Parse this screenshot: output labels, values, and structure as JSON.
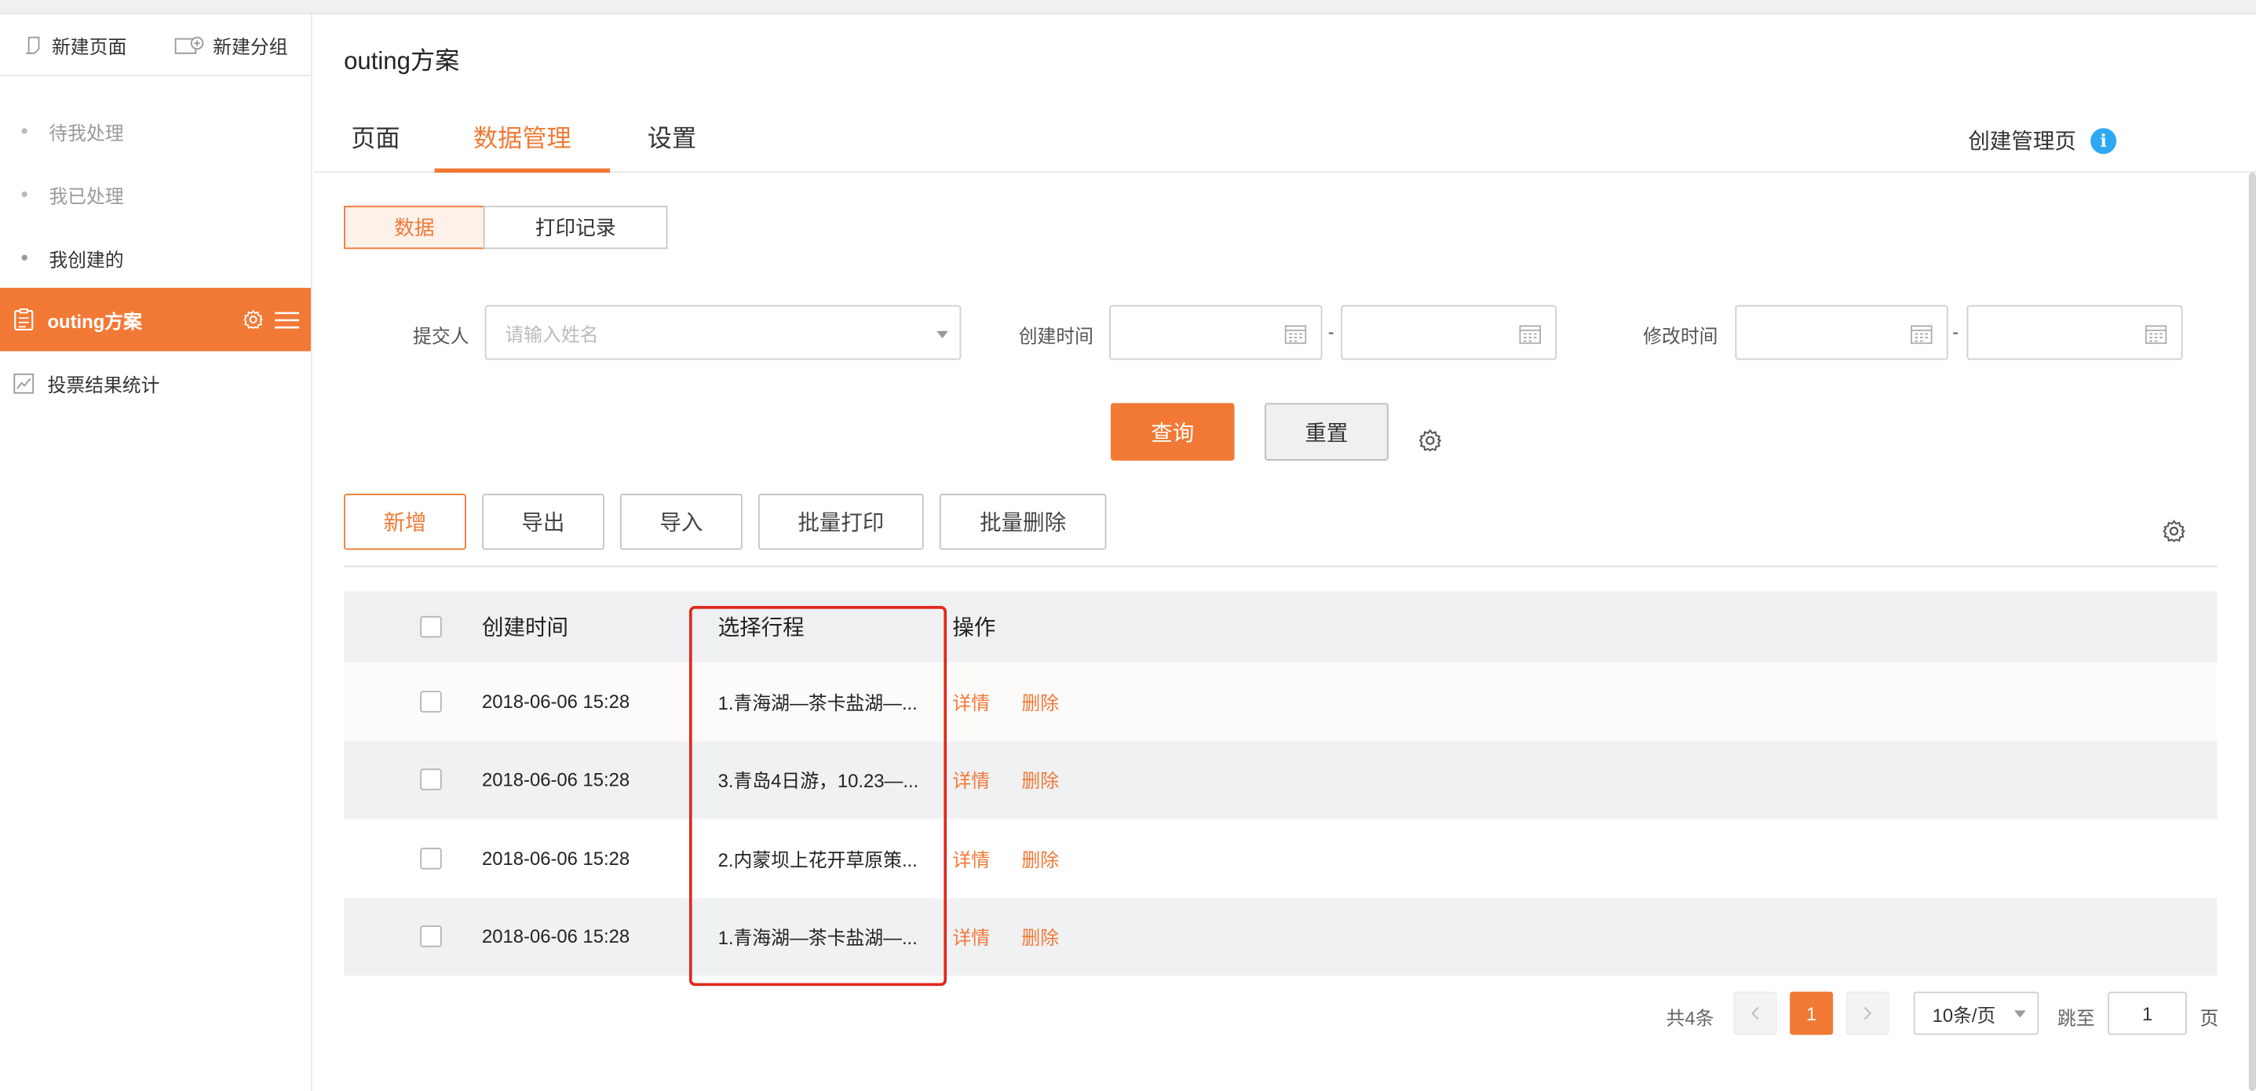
{
  "sidebar": {
    "actions": {
      "new_page": "新建页面",
      "new_group": "新建分组"
    },
    "items": [
      {
        "label": "待我处理"
      },
      {
        "label": "我已处理"
      },
      {
        "label": "我创建的"
      },
      {
        "label": "outing方案"
      },
      {
        "label": "投票结果统计"
      }
    ]
  },
  "header": {
    "title": "outing方案",
    "tabs": [
      "页面",
      "数据管理",
      "设置"
    ],
    "create_admin_page": "创建管理页"
  },
  "segment": {
    "data": "数据",
    "print_log": "打印记录"
  },
  "filters": {
    "submitter_label": "提交人",
    "submitter_placeholder": "请输入姓名",
    "created_label": "创建时间",
    "modified_label": "修改时间",
    "range_sep": "-",
    "query": "查询",
    "reset": "重置"
  },
  "toolbar": {
    "add": "新增",
    "export": "导出",
    "import": "导入",
    "batch_print": "批量打印",
    "batch_delete": "批量删除"
  },
  "table": {
    "columns": {
      "created": "创建时间",
      "route": "选择行程",
      "actions": "操作"
    },
    "rows": [
      {
        "created": "2018-06-06 15:28",
        "route": "1.青海湖—茶卡盐湖—...",
        "detail": "详情",
        "delete": "删除"
      },
      {
        "created": "2018-06-06 15:28",
        "route": "3.青岛4日游，10.23—...",
        "detail": "详情",
        "delete": "删除"
      },
      {
        "created": "2018-06-06 15:28",
        "route": "2.内蒙坝上花开草原策...",
        "detail": "详情",
        "delete": "删除"
      },
      {
        "created": "2018-06-06 15:28",
        "route": "1.青海湖—茶卡盐湖—...",
        "detail": "详情",
        "delete": "删除"
      }
    ]
  },
  "pagination": {
    "total": "共4条",
    "current_page": "1",
    "page_size": "10条/页",
    "goto_label": "跳至",
    "goto_value": "1",
    "page_unit": "页"
  },
  "colors": {
    "accent": "#f27935",
    "info": "#2ea8f2",
    "highlight": "#e0281f"
  }
}
